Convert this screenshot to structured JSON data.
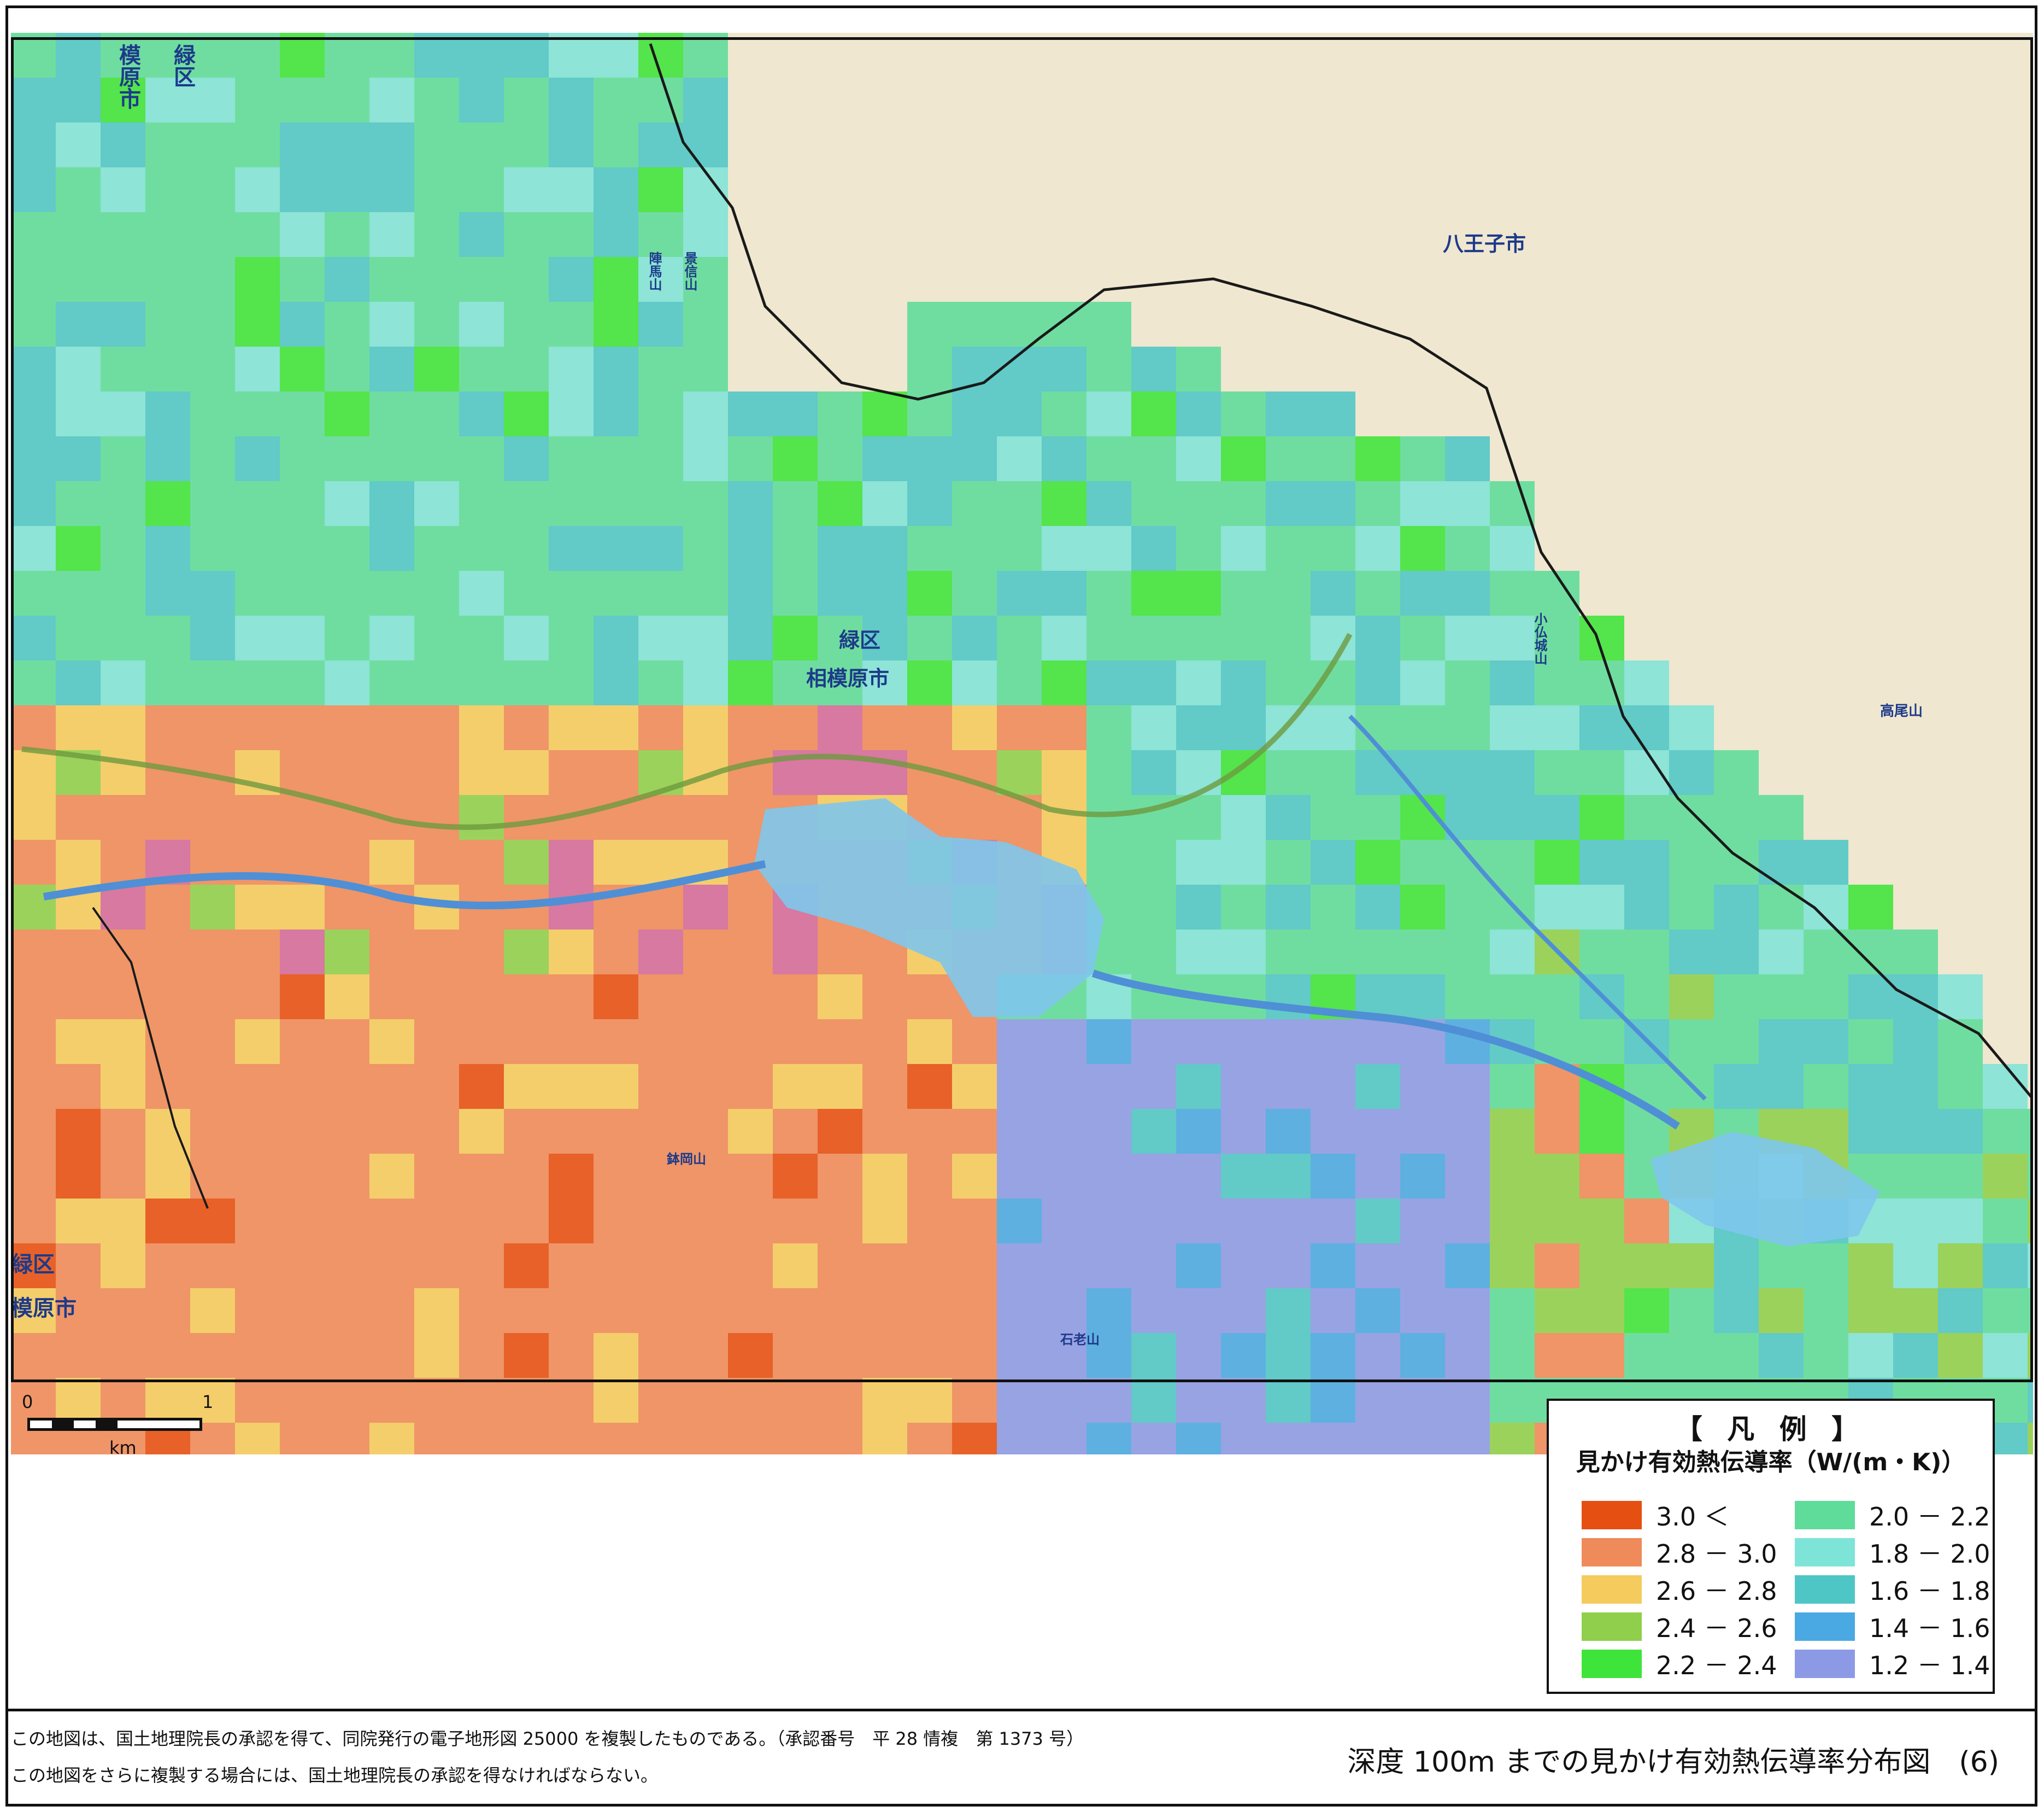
{
  "map": {
    "labels": {
      "hachioji": "八王子市",
      "midori_center": "緑区",
      "sagamihara_center": "相模原市",
      "midori_topleft": "緑区",
      "sagamihara_topleft": "模原市",
      "midori_left": "緑区",
      "sagamihara_left": "模原市",
      "takaosan": "高尾山",
      "jinbayama": "陣馬山",
      "kagesan": "景信山",
      "kobotokeshiro": "小仏城山",
      "mount_ishirou": "石老山",
      "mount_kayamaru": "鉢岡山"
    },
    "colors": {
      "background_terrain": "#efe7cf",
      "lake": "#7ec7ec",
      "river": "#4f8fd6",
      "border_line": "#1a1a1a"
    }
  },
  "scale": {
    "zero": "0",
    "one": "1",
    "unit": "km"
  },
  "legend": {
    "title": "【 凡 例 】",
    "subtitle": "見かけ有効熱伝導率（W/(m・K)）",
    "items": [
      {
        "label": "3.0 ＜",
        "color": "#e64f12"
      },
      {
        "label": "2.8 － 3.0",
        "color": "#ef8a5a"
      },
      {
        "label": "2.6 － 2.8",
        "color": "#f5cb5d"
      },
      {
        "label": "2.4 － 2.6",
        "color": "#8fcf4b"
      },
      {
        "label": "2.2 － 2.4",
        "color": "#3fe43a"
      },
      {
        "label": "2.0 － 2.2",
        "color": "#5fdc9a"
      },
      {
        "label": "1.8 － 2.0",
        "color": "#7fe4d8"
      },
      {
        "label": "1.6 － 1.8",
        "color": "#4fc6c6"
      },
      {
        "label": "1.4 － 1.6",
        "color": "#4aa9e2"
      },
      {
        "label": "1.2 － 1.4",
        "color": "#8c9ae6"
      }
    ]
  },
  "footer": {
    "note1": "この地図は、国土地理院長の承認を得て、同院発行の電子地形図 25000 を複製したものである。（承認番号　平 28 情複　第 1373 号）",
    "note2": "この地図をさらに複製する場合には、国土地理院長の承認を得なければならない。",
    "title": "深度 100m までの見かけ有効熱伝導率分布図　(6)"
  }
}
